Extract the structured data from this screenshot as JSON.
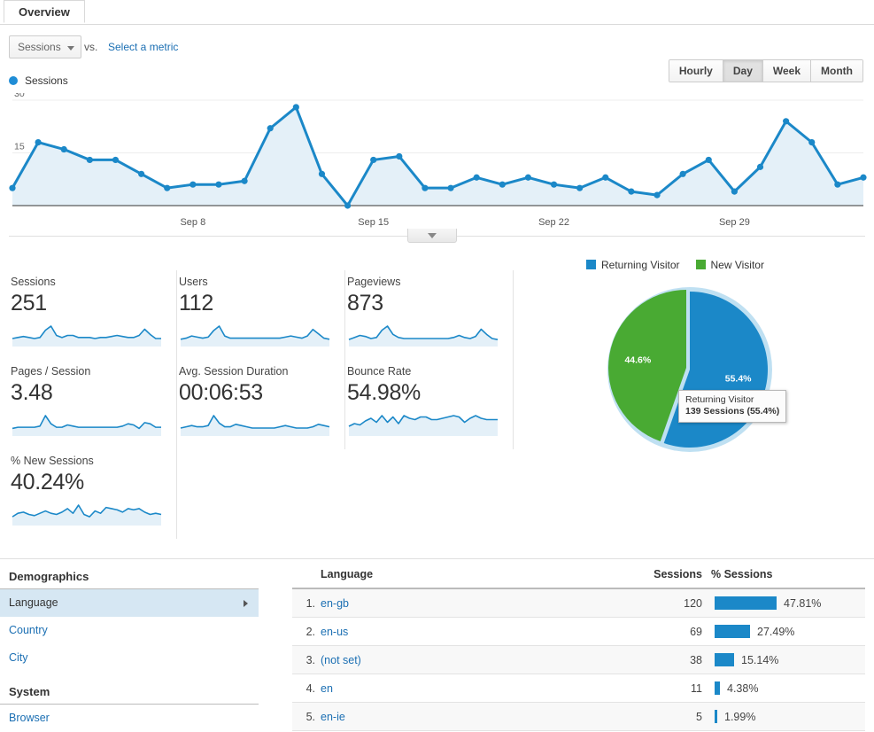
{
  "tab": {
    "label": "Overview"
  },
  "controls": {
    "metric_select": "Sessions",
    "vs_label": "vs.",
    "select_metric_link": "Select a metric",
    "granularity": [
      {
        "label": "Hourly",
        "active": false
      },
      {
        "label": "Day",
        "active": true
      },
      {
        "label": "Week",
        "active": false
      },
      {
        "label": "Month",
        "active": false
      }
    ],
    "expand_icon": "chevron-down-icon"
  },
  "line_chart_legend": {
    "series_label": "Sessions",
    "dot_color": "#1f8dd6"
  },
  "chart_data": {
    "type": "line",
    "title": "Sessions",
    "xlabel": "",
    "ylabel": "Sessions",
    "ylim": [
      0,
      30
    ],
    "yticks": [
      15,
      30
    ],
    "grid": true,
    "line_color": "#1b88c8",
    "fill_color": "#e4f0f8",
    "xticks": [
      "Sep 8",
      "Sep 15",
      "Sep 22",
      "Sep 29"
    ],
    "x": [
      "Sep 1",
      "Sep 2",
      "Sep 3",
      "Sep 4",
      "Sep 5",
      "Sep 6",
      "Sep 7",
      "Sep 8",
      "Sep 9",
      "Sep 10",
      "Sep 11",
      "Sep 12",
      "Sep 13",
      "Sep 14",
      "Sep 15",
      "Sep 16",
      "Sep 17",
      "Sep 18",
      "Sep 19",
      "Sep 20",
      "Sep 21",
      "Sep 22",
      "Sep 23",
      "Sep 24",
      "Sep 25",
      "Sep 26",
      "Sep 27",
      "Sep 28",
      "Sep 29",
      "Sep 30",
      "Oct 1",
      "Oct 2",
      "Oct 3"
    ],
    "values": [
      5,
      18,
      16,
      13,
      13,
      9,
      5,
      6,
      6,
      7,
      22,
      28,
      9,
      0,
      13,
      14,
      5,
      5,
      8,
      6,
      8,
      6,
      5,
      8,
      4,
      3,
      9,
      13,
      4,
      11,
      24,
      18,
      6,
      8
    ],
    "series": [
      {
        "name": "Sessions",
        "values": [
          5,
          18,
          16,
          13,
          13,
          9,
          5,
          6,
          6,
          7,
          22,
          28,
          9,
          0,
          13,
          14,
          5,
          5,
          8,
          6,
          8,
          6,
          5,
          8,
          4,
          3,
          9,
          13,
          4,
          11,
          24,
          18,
          6,
          8
        ]
      }
    ]
  },
  "metric_cards": [
    {
      "label": "Sessions",
      "value": "251",
      "spark": [
        6,
        7,
        8,
        7,
        6,
        7,
        14,
        18,
        9,
        7,
        9,
        9,
        7,
        7,
        7,
        6,
        7,
        7,
        8,
        9,
        8,
        7,
        7,
        9,
        15,
        10,
        6,
        6
      ]
    },
    {
      "label": "Users",
      "value": "112",
      "spark": [
        5,
        6,
        8,
        7,
        6,
        7,
        13,
        17,
        8,
        6,
        6,
        6,
        6,
        6,
        6,
        6,
        6,
        6,
        6,
        7,
        8,
        7,
        6,
        8,
        14,
        10,
        6,
        5
      ]
    },
    {
      "label": "Pageviews",
      "value": "873",
      "spark": [
        5,
        7,
        9,
        8,
        6,
        7,
        14,
        18,
        10,
        7,
        6,
        6,
        6,
        6,
        6,
        6,
        6,
        6,
        6,
        7,
        9,
        7,
        6,
        8,
        15,
        10,
        6,
        5
      ]
    },
    {
      "label": "Pages / Session",
      "value": "3.48",
      "spark": [
        5,
        6,
        6,
        6,
        6,
        7,
        16,
        9,
        6,
        6,
        8,
        7,
        6,
        6,
        6,
        6,
        6,
        6,
        6,
        6,
        7,
        9,
        8,
        5,
        10,
        9,
        6,
        6
      ]
    },
    {
      "label": "Avg. Session Duration",
      "value": "00:06:53",
      "spark": [
        5,
        6,
        7,
        6,
        6,
        7,
        15,
        9,
        6,
        6,
        8,
        7,
        6,
        5,
        5,
        5,
        5,
        5,
        6,
        7,
        6,
        5,
        5,
        5,
        6,
        8,
        7,
        6
      ]
    },
    {
      "label": "Bounce Rate",
      "value": "54.98%",
      "spark": [
        6,
        8,
        7,
        10,
        12,
        9,
        14,
        9,
        13,
        8,
        14,
        12,
        11,
        13,
        13,
        11,
        11,
        12,
        13,
        14,
        13,
        9,
        12,
        14,
        12,
        11,
        11,
        11
      ]
    },
    {
      "label": "% New Sessions",
      "value": "40.24%",
      "spark": [
        6,
        9,
        10,
        8,
        7,
        9,
        11,
        9,
        8,
        10,
        13,
        9,
        16,
        8,
        6,
        11,
        9,
        14,
        13,
        12,
        10,
        13,
        12,
        13,
        10,
        8,
        9,
        8
      ]
    }
  ],
  "pie": {
    "legend": [
      {
        "label": "Returning Visitor",
        "color": "#1b88c8"
      },
      {
        "label": "New Visitor",
        "color": "#49aa33"
      }
    ],
    "type": "pie",
    "slices": [
      {
        "name": "Returning Visitor",
        "percent": 55.4,
        "label": "55.4%",
        "sessions": 139,
        "color": "#1b88c8",
        "highlighted": true
      },
      {
        "name": "New Visitor",
        "percent": 44.6,
        "label": "44.6%",
        "sessions": 112,
        "color": "#49aa33",
        "highlighted": false
      }
    ],
    "tooltip": {
      "title": "Returning Visitor",
      "value": "139 Sessions (55.4%)"
    }
  },
  "demographics": {
    "section1_title": "Demographics",
    "items1": [
      {
        "label": "Language",
        "selected": true
      },
      {
        "label": "Country",
        "selected": false
      },
      {
        "label": "City",
        "selected": false
      }
    ],
    "section2_title": "System",
    "items2": [
      {
        "label": "Browser",
        "selected": false
      }
    ]
  },
  "language_table": {
    "headers": {
      "name": "Language",
      "sessions": "Sessions",
      "pct": "% Sessions"
    },
    "rows": [
      {
        "idx": "1.",
        "name": "en-gb",
        "sessions": "120",
        "pct": "47.81%",
        "pct_value": 47.81
      },
      {
        "idx": "2.",
        "name": "en-us",
        "sessions": "69",
        "pct": "27.49%",
        "pct_value": 27.49
      },
      {
        "idx": "3.",
        "name": "(not set)",
        "sessions": "38",
        "pct": "15.14%",
        "pct_value": 15.14
      },
      {
        "idx": "4.",
        "name": "en",
        "sessions": "11",
        "pct": "4.38%",
        "pct_value": 4.38
      },
      {
        "idx": "5.",
        "name": "en-ie",
        "sessions": "5",
        "pct": "1.99%",
        "pct_value": 1.99
      }
    ]
  }
}
